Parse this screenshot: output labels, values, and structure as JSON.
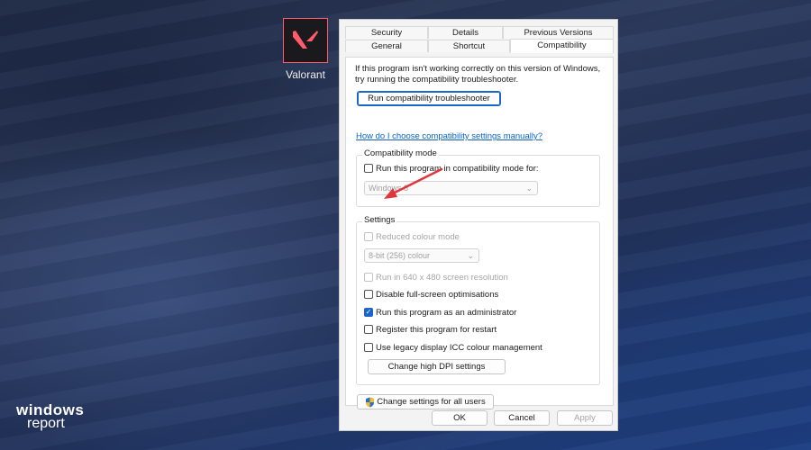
{
  "desktop": {
    "icon_label": "Valorant",
    "icon_name": "valorant-app-icon",
    "watermark_line1": "windows",
    "watermark_line2": "report"
  },
  "dialog": {
    "tabs_row1": [
      "Security",
      "Details",
      "Previous Versions"
    ],
    "tabs_row2": [
      "General",
      "Shortcut",
      "Compatibility"
    ],
    "active_tab": "Compatibility",
    "intro_text": "If this program isn't working correctly on this version of Windows, try running the compatibility troubleshooter.",
    "troubleshooter_button": "Run compatibility troubleshooter",
    "manual_link": "How do I choose compatibility settings manually?",
    "compat_group": {
      "legend": "Compatibility mode",
      "checkbox_label": "Run this program in compatibility mode for:",
      "checked": false,
      "os_select_value": "Windows 8"
    },
    "settings_group": {
      "legend": "Settings",
      "reduced_colour": {
        "label": "Reduced colour mode",
        "checked": false,
        "disabled": true
      },
      "colour_select_value": "8-bit (256) colour",
      "resolution": {
        "label": "Run in 640 x 480 screen resolution",
        "checked": false,
        "disabled": true
      },
      "fullscreen": {
        "label": "Disable full-screen optimisations",
        "checked": false
      },
      "admin": {
        "label": "Run this program as an administrator",
        "checked": true
      },
      "restart": {
        "label": "Register this program for restart",
        "checked": false
      },
      "icc": {
        "label": "Use legacy display ICC colour management",
        "checked": false
      },
      "dpi_button": "Change high DPI settings"
    },
    "all_users_button": "Change settings for all users",
    "footer": {
      "ok": "OK",
      "cancel": "Cancel",
      "apply": "Apply"
    }
  },
  "colors": {
    "accent": "#1a66c9",
    "link": "#0a63c4",
    "arrow": "#e0353d",
    "valorant": "#ff5b6a"
  }
}
